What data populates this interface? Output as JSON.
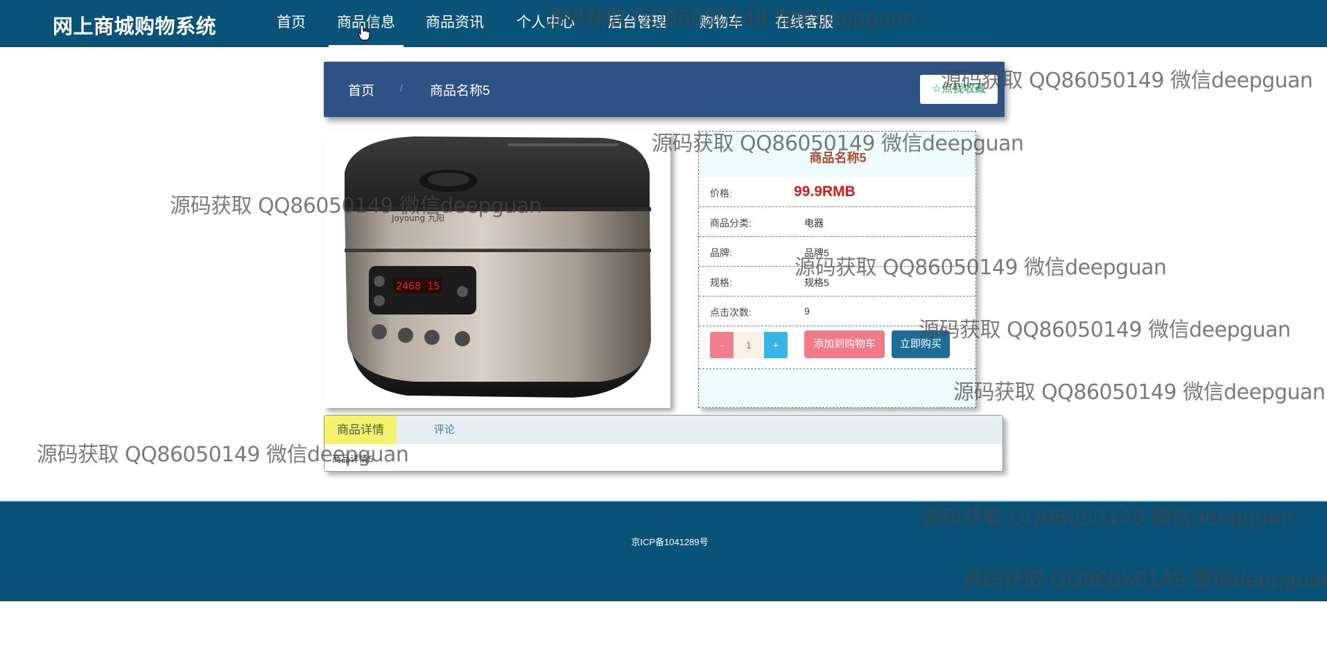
{
  "nav": {
    "brand": "网上商城购物系统",
    "items": [
      {
        "label": "首页"
      },
      {
        "label": "商品信息"
      },
      {
        "label": "商品资讯"
      },
      {
        "label": "个人中心"
      },
      {
        "label": "后台管理"
      },
      {
        "label": "购物车"
      },
      {
        "label": "在线客服"
      }
    ],
    "active": "商品信息"
  },
  "breadcrumb": {
    "home": "首页",
    "separator": "/",
    "current": "商品名称5",
    "favorite_label": "☆点我收藏"
  },
  "product": {
    "image_icon": "rice-cooker-image",
    "title": "商品名称5",
    "price_label": "价格:",
    "price": "99.9RMB",
    "category_label": "商品分类:",
    "category": "电器",
    "brand_label": "品牌:",
    "brand": "品牌5",
    "spec_label": "规格:",
    "spec": "规格5",
    "clicks_label": "点击次数:",
    "clicks": "9",
    "qty_minus": "-",
    "qty_value": "1",
    "qty_plus": "+",
    "add_to_cart": "添加到购物车",
    "buy_now": "立即购买"
  },
  "tabs": {
    "detail": "商品详情",
    "comments": "评论",
    "detail_content": "商品详情5"
  },
  "footer": {
    "icp": "京ICP备1041289号"
  },
  "watermark": {
    "text": "源码获取 QQ86050149 微信deepguan"
  },
  "colors": {
    "nav_bg": "#0a5378",
    "crumb_bg": "#2f5284",
    "price": "#d41a1a",
    "title": "#b0492c",
    "cart_btn": "#f07a86",
    "buy_btn": "#1e6c98"
  }
}
